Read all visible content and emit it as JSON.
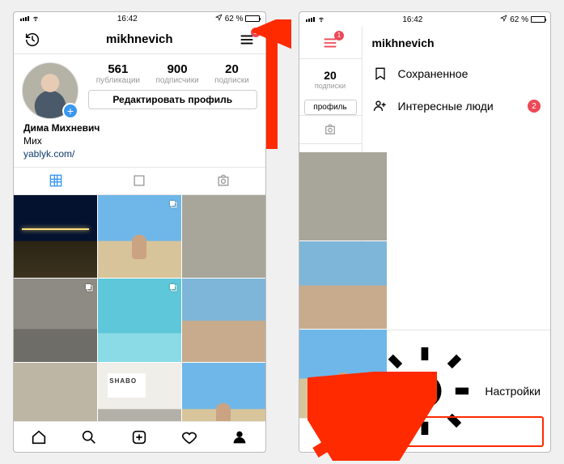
{
  "status": {
    "time": "16:42",
    "battery_pct": "62 %"
  },
  "left": {
    "username": "mikhnevich",
    "menu_badge": "1",
    "stats": {
      "posts_n": "561",
      "posts_l": "публикации",
      "followers_n": "900",
      "followers_l": "подписчики",
      "following_n": "20",
      "following_l": "подписки"
    },
    "edit_label": "Редактировать профиль",
    "bio_name": "Дима Михневич",
    "bio_sub": "Мих",
    "bio_link": "yablyk.com/"
  },
  "right": {
    "username": "mikhnevich",
    "menu_badge": "1",
    "visible_following_n": "20",
    "visible_following_l": "подписки",
    "edit_fragment": "профиль",
    "menu_saved": "Сохраненное",
    "menu_discover": "Интересные люди",
    "discover_badge": "2",
    "settings_label": "Настройки"
  }
}
